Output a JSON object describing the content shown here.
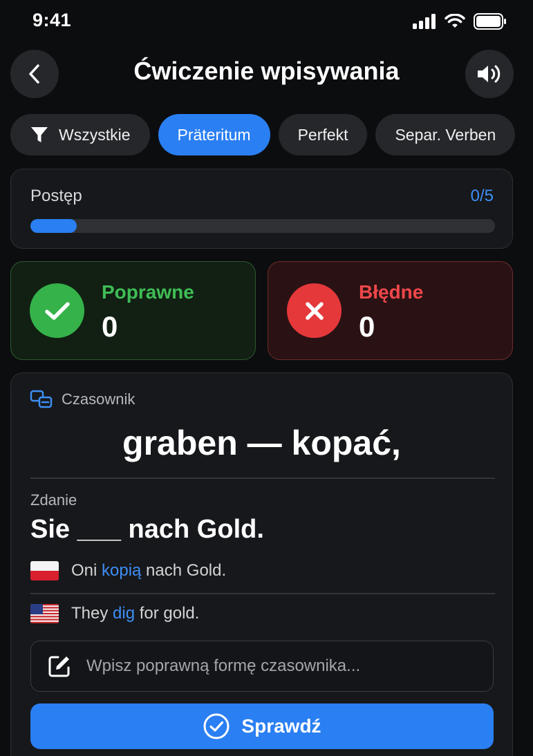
{
  "status_bar": {
    "time": "9:41"
  },
  "header": {
    "title": "Ćwiczenie wpisywania"
  },
  "filters": [
    {
      "label": "Wszystkie",
      "icon": "filter-icon",
      "active": false
    },
    {
      "label": "Präteritum",
      "active": true
    },
    {
      "label": "Perfekt",
      "active": false
    },
    {
      "label": "Separ. Verben",
      "active": false
    }
  ],
  "progress": {
    "label": "Postęp",
    "count": "0/5",
    "fraction": 0.1
  },
  "scores": {
    "correct": {
      "label": "Poprawne",
      "value": "0"
    },
    "wrong": {
      "label": "Błędne",
      "value": "0"
    }
  },
  "exercise": {
    "tag": "Czasownik",
    "verb": "graben — kopać,",
    "sentence_label": "Zdanie",
    "sentence": "Sie ___ nach Gold.",
    "translation_pl": {
      "before": "Oni ",
      "highlight": "kopią",
      "after": " nach Gold."
    },
    "translation_en": {
      "before": "They ",
      "highlight": "dig",
      "after": " for gold."
    },
    "input_placeholder": "Wpisz poprawną formę czasownika...",
    "check_label": "Sprawdź"
  },
  "colors": {
    "accent": "#2a7ff2",
    "correct": "#35b24a",
    "wrong": "#e5383b",
    "background": "#0c0d0f"
  }
}
